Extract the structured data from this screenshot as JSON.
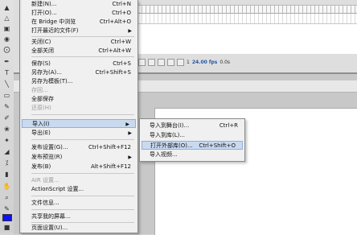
{
  "file_menu": {
    "items": [
      {
        "label": "新建(N)...",
        "shortcut": "Ctrl+N"
      },
      {
        "label": "打开(O)...",
        "shortcut": "Ctrl+O"
      },
      {
        "label": "在 Bridge 中浏览",
        "shortcut": "Ctrl+Alt+O"
      },
      {
        "label": "打开最近的文件(F)"
      },
      {
        "label": "关闭(C)",
        "shortcut": "Ctrl+W"
      },
      {
        "label": "全部关闭",
        "shortcut": "Ctrl+Alt+W"
      },
      {
        "label": "保存(S)",
        "shortcut": "Ctrl+S"
      },
      {
        "label": "另存为(A)...",
        "shortcut": "Ctrl+Shift+S"
      },
      {
        "label": "另存为模板(T)..."
      },
      {
        "label": "存回..."
      },
      {
        "label": "全部保存"
      },
      {
        "label": "还原(H)"
      },
      {
        "label": "导入(I)"
      },
      {
        "label": "导出(E)"
      },
      {
        "label": "发布设置(G)...",
        "shortcut": "Ctrl+Shift+F12"
      },
      {
        "label": "发布预览(R)"
      },
      {
        "label": "发布(B)",
        "shortcut": "Alt+Shift+F12"
      },
      {
        "label": "AIR 设置..."
      },
      {
        "label": "ActionScript 设置..."
      },
      {
        "label": "文件信息..."
      },
      {
        "label": "共享我的屏幕..."
      },
      {
        "label": "页面设置(U)..."
      }
    ]
  },
  "import_menu": {
    "items": [
      {
        "label": "导入到舞台(I)...",
        "shortcut": "Ctrl+R"
      },
      {
        "label": "导入到库(L)..."
      },
      {
        "label": "打开外部库(O)...",
        "shortcut": "Ctrl+Shift+O"
      },
      {
        "label": "导入视频..."
      }
    ]
  },
  "timeline": {
    "frame": "1",
    "fps": "24.00 fps",
    "time": "0.0s"
  }
}
